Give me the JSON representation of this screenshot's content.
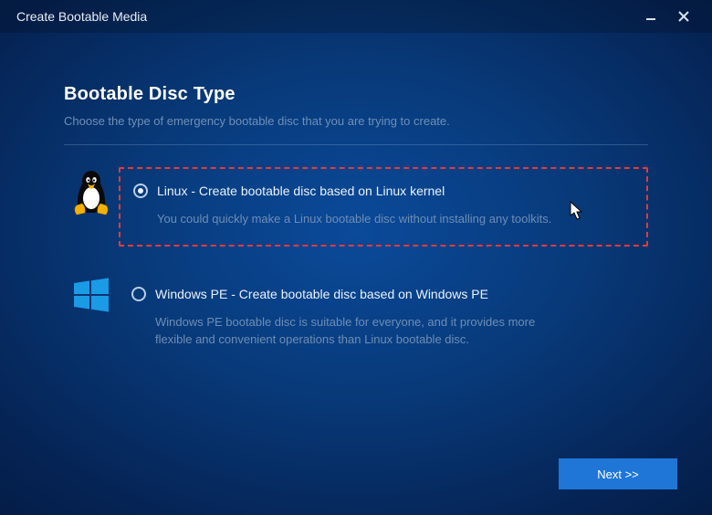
{
  "window": {
    "title": "Create Bootable Media"
  },
  "page": {
    "heading": "Bootable Disc Type",
    "subheading": "Choose the type of emergency bootable disc that you are trying to create."
  },
  "options": {
    "linux": {
      "title": "Linux - Create bootable disc based on Linux kernel",
      "desc": "You could quickly make a Linux bootable disc without installing any toolkits.",
      "selected": true
    },
    "winpe": {
      "title": "Windows PE - Create bootable disc based on Windows PE",
      "desc": "Windows PE bootable disc is suitable for everyone, and it provides more flexible and convenient operations than Linux bootable disc.",
      "selected": false
    }
  },
  "footer": {
    "next_label": "Next >>"
  }
}
